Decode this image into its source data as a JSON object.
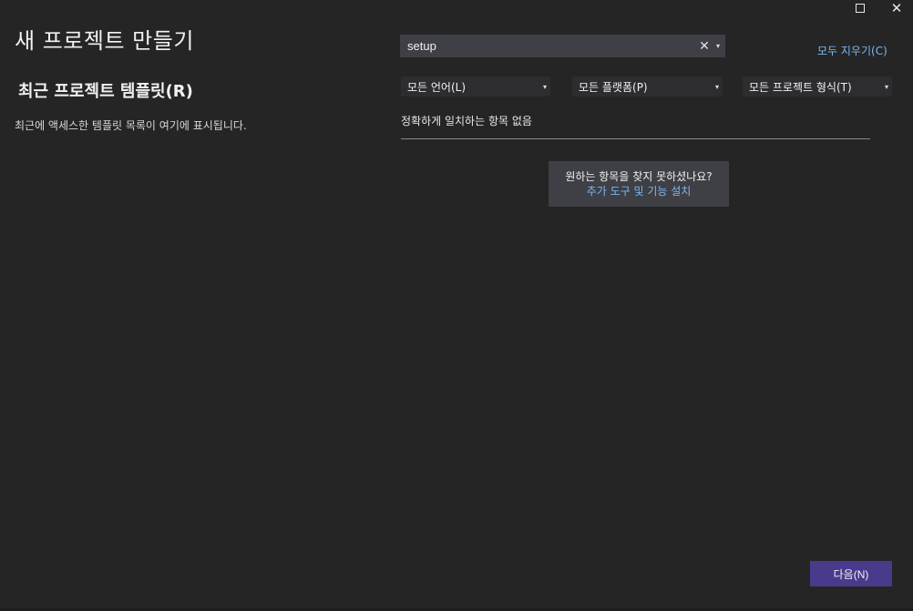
{
  "window": {
    "title": "새 프로젝트 만들기"
  },
  "icons": {
    "maximize": "maximize-icon",
    "close": "close-icon",
    "search_clear": "clear-icon",
    "dropdown": "chevron-down-icon"
  },
  "recent": {
    "heading": "최근 프로젝트 템플릿(R)",
    "empty_message": "최근에 액세스한 템플릿 목록이 여기에 표시됩니다."
  },
  "search": {
    "value": "setup",
    "clear_glyph": "✕",
    "dropdown_glyph": "▾"
  },
  "clear_all": "모두 지우기(C)",
  "filters": [
    {
      "label": "모든 언어(L)",
      "caret": "▾"
    },
    {
      "label": "모든 플랫폼(P)",
      "caret": "▾"
    },
    {
      "label": "모든 프로젝트 형식(T)",
      "caret": "▾"
    }
  ],
  "results": {
    "no_match": "정확하게 일치하는 항목 없음"
  },
  "not_found": {
    "question": "원하는 항목을 찾지 못하셨나요?",
    "link": "추가 도구 및 기능 설치"
  },
  "footer": {
    "next_label": "다음(N)"
  },
  "colors": {
    "background": "#252526",
    "accent_button": "#4a3a8c",
    "link": "#7bb7f0",
    "input_bg": "#3f3f46"
  }
}
